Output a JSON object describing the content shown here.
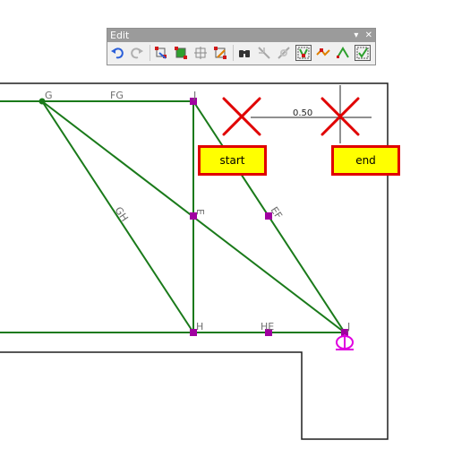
{
  "toolbar": {
    "title": "Edit",
    "dropdown_glyph": "▾",
    "close_glyph": "✕",
    "buttons": [
      {
        "name": "undo",
        "icon": "undo-icon"
      },
      {
        "name": "redo",
        "icon": "redo-icon"
      },
      {
        "name": "edit-1",
        "icon": "vertex-edit-icon"
      },
      {
        "name": "edit-2",
        "icon": "vertex-move-icon"
      },
      {
        "name": "edit-3",
        "icon": "vertex-grid-icon"
      },
      {
        "name": "edit-4",
        "icon": "vertex-add-icon"
      },
      {
        "name": "find",
        "icon": "binoculars-icon"
      },
      {
        "name": "edit-5",
        "icon": "split-icon"
      },
      {
        "name": "edit-6",
        "icon": "merge-icon"
      },
      {
        "name": "edit-7",
        "icon": "select-vertex-icon"
      },
      {
        "name": "edit-8",
        "icon": "reshape-icon"
      },
      {
        "name": "edit-9",
        "icon": "arc-icon"
      },
      {
        "name": "edit-10",
        "icon": "validate-icon"
      }
    ]
  },
  "drawing": {
    "node_labels": {
      "G": "G",
      "J": "J",
      "H": "H",
      "I": "J",
      "E": "E"
    },
    "member_labels": {
      "FG": "FG",
      "GH": "GH",
      "EF": "EF",
      "HE": "HE"
    },
    "dimension_value": "0.50"
  },
  "markers": {
    "start_label": "start",
    "end_label": "end"
  },
  "colors": {
    "member": "#1a7a1a",
    "node": "#a000a0",
    "support": "#e000e0",
    "marker_x": "#e00000",
    "button_fill": "#ffff00",
    "button_border": "#e00000"
  }
}
